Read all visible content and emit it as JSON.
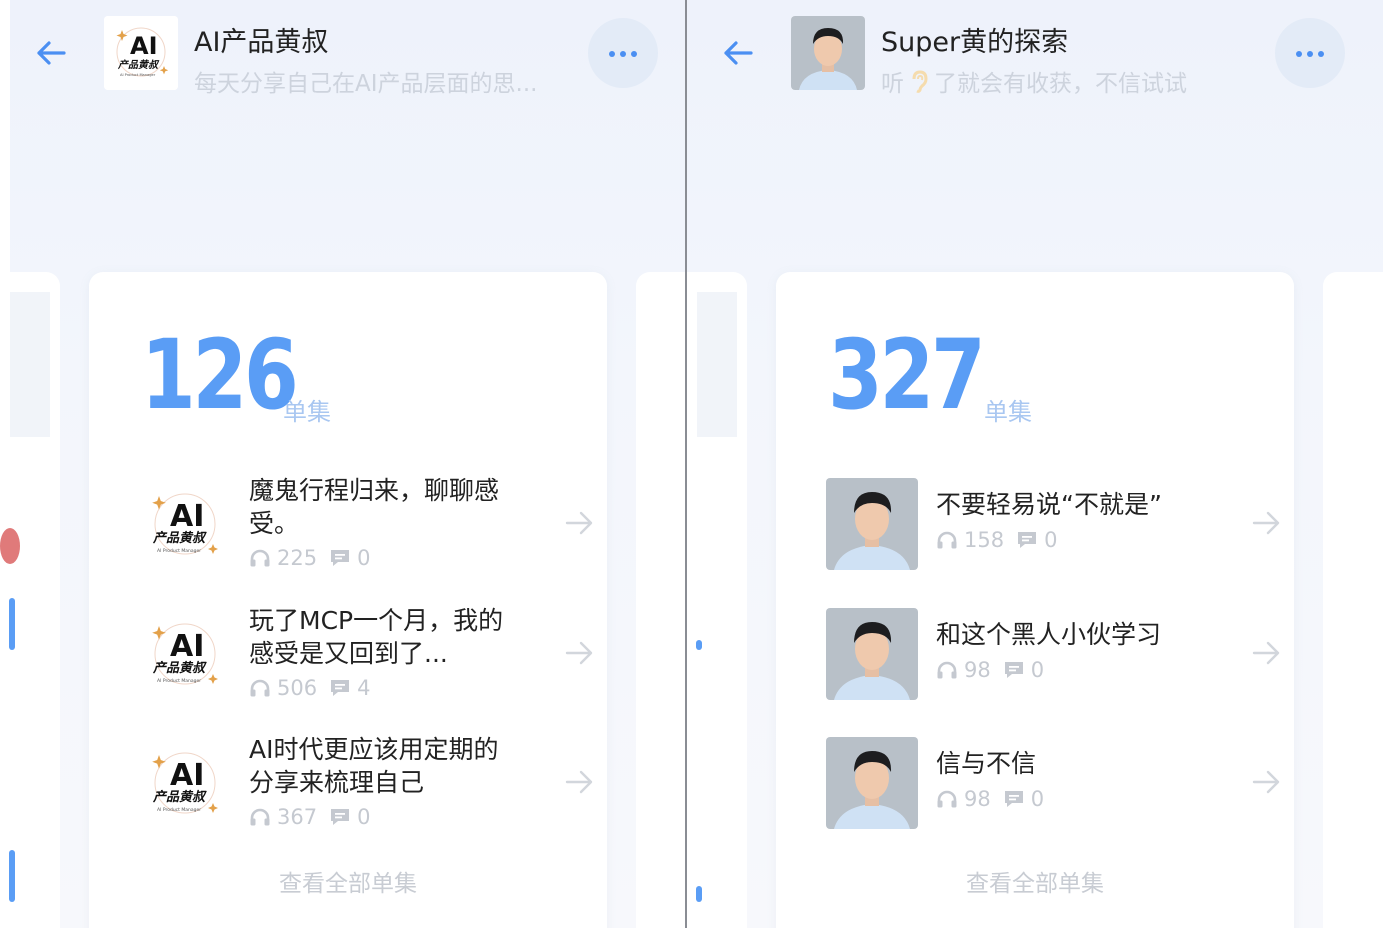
{
  "left": {
    "title": "AI产品黄叔",
    "subtitle": "每天分享自己在AI产品层面的思...",
    "count": "126",
    "unit": "单集",
    "avatar_text": {
      "big": "AI",
      "small": "产品黄叔",
      "tiny": "AI Product Manager"
    },
    "episodes": [
      {
        "title": "魔鬼行程归来，聊聊感受。",
        "plays": "225",
        "comments": "0"
      },
      {
        "title": "玩了MCP一个月，我的感受是又回到了...",
        "plays": "506",
        "comments": "4"
      },
      {
        "title": "AI时代更应该用定期的分享来梳理自己",
        "plays": "367",
        "comments": "0"
      }
    ],
    "view_all": "查看全部单集"
  },
  "right": {
    "title": "Super黄的探索",
    "subtitle_pre": "听",
    "subtitle_post": "了就会有收获，不信试试",
    "count": "327",
    "unit": "单集",
    "episodes": [
      {
        "title": "不要轻易说“不就是”",
        "plays": "158",
        "comments": "0"
      },
      {
        "title": "和这个黑人小伙学习",
        "plays": "98",
        "comments": "0"
      },
      {
        "title": "信与不信",
        "plays": "98",
        "comments": "0"
      }
    ],
    "view_all": "查看全部单集"
  },
  "colors": {
    "accent": "#5a9df5",
    "back_arrow": "#4b8ff2",
    "muted": "#c5c9d0"
  }
}
